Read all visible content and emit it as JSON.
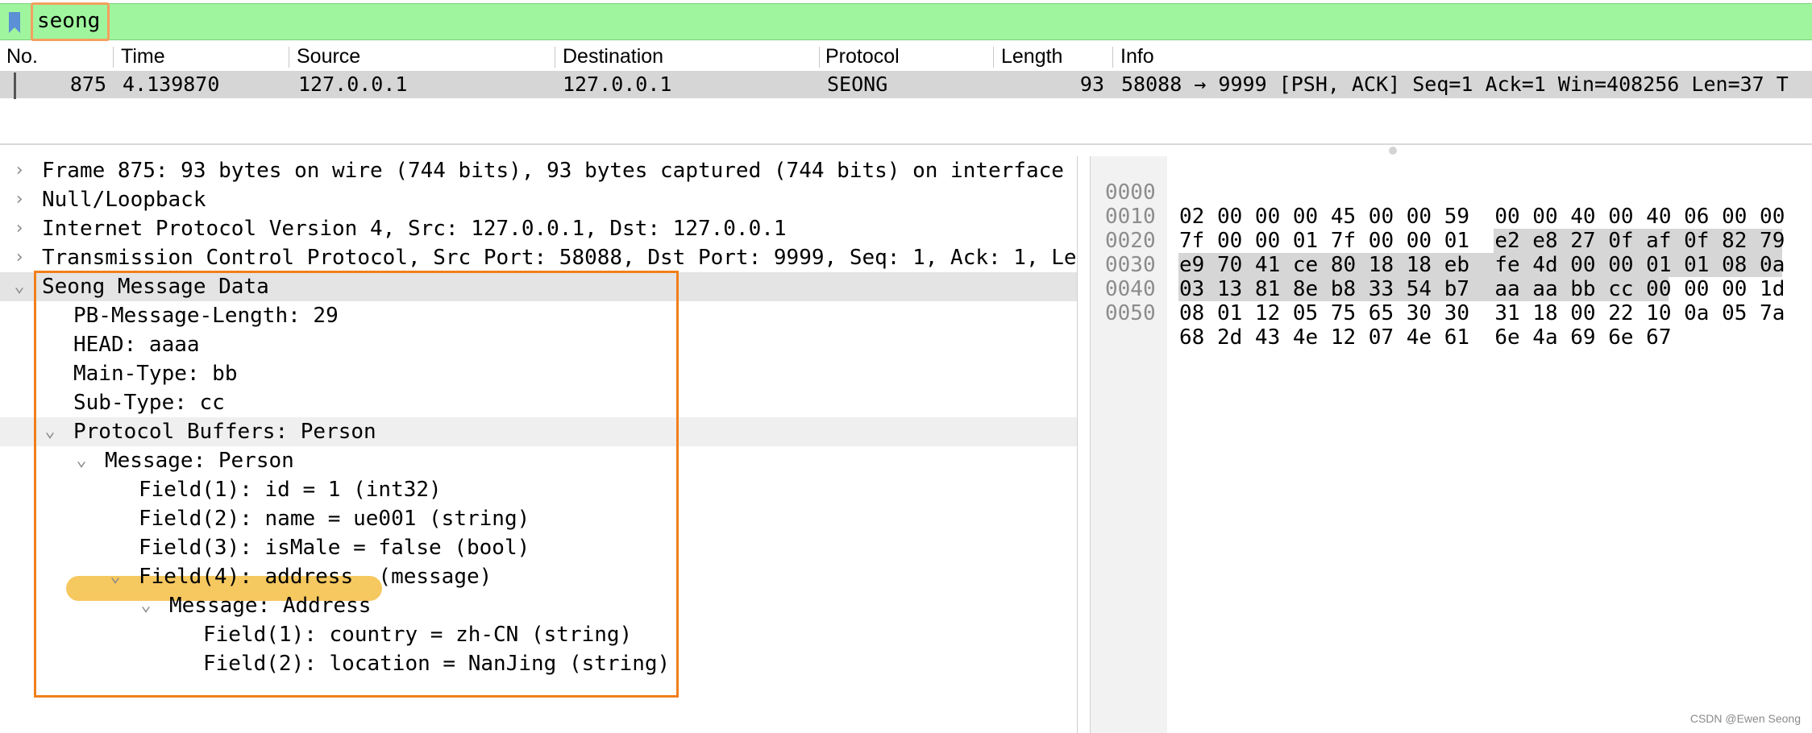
{
  "filter": {
    "text": "seong",
    "bookmark_icon": "bookmark-icon"
  },
  "packet_list": {
    "columns": [
      "No.",
      "Time",
      "Source",
      "Destination",
      "Protocol",
      "Length",
      "Info"
    ],
    "row": {
      "no": "875",
      "time": "4.139870",
      "source": "127.0.0.1",
      "destination": "127.0.0.1",
      "protocol": "SEONG",
      "length": "93",
      "info": "58088 → 9999 [PSH, ACK] Seq=1 Ack=1 Win=408256 Len=37 T"
    }
  },
  "details": [
    {
      "text": "Frame 875: 93 bytes on wire (744 bits), 93 bytes captured (744 bits) on interface",
      "expander": "›"
    },
    {
      "text": "Null/Loopback",
      "expander": "›"
    },
    {
      "text": "Internet Protocol Version 4, Src: 127.0.0.1, Dst: 127.0.0.1",
      "expander": "›"
    },
    {
      "text": "Transmission Control Protocol, Src Port: 58088, Dst Port: 9999, Seq: 1, Ack: 1, Len",
      "expander": "›"
    },
    {
      "text": "Seong Message Data",
      "expander": "⌄"
    },
    {
      "text": "PB-Message-Length: 29",
      "expander": ""
    },
    {
      "text": "HEAD: aaaa",
      "expander": ""
    },
    {
      "text": "Main-Type: bb",
      "expander": ""
    },
    {
      "text": "Sub-Type: cc",
      "expander": ""
    },
    {
      "text": "Protocol Buffers: Person",
      "expander": "⌄"
    },
    {
      "text": "Message: Person",
      "expander": "⌄"
    },
    {
      "text": "Field(1): id = 1 (int32)",
      "expander": ""
    },
    {
      "text": "Field(2): name = ue001 (string)",
      "expander": ""
    },
    {
      "text": "Field(3): isMale = false (bool)",
      "expander": ""
    },
    {
      "text": "Field(4): address  (message)",
      "expander": "⌄"
    },
    {
      "text": "Message: Address",
      "expander": "⌄"
    },
    {
      "text": "Field(1): country = zh-CN (string)",
      "expander": ""
    },
    {
      "text": "Field(2): location = NanJing (string)",
      "expander": ""
    }
  ],
  "hex": [
    {
      "offset": "0000",
      "bytes": "02 00 00 00 45 00 00 59  00 00 40 00 40 06 00 00"
    },
    {
      "offset": "0010",
      "bytes": "7f 00 00 01 7f 00 00 01  e2 e8 27 0f af 0f 82 79"
    },
    {
      "offset": "0020",
      "bytes": "e9 70 41 ce 80 18 18 eb  fe 4d 00 00 01 01 08 0a"
    },
    {
      "offset": "0030",
      "bytes": "03 13 81 8e b8 33 54 b7  aa aa bb cc 00 00 00 1d"
    },
    {
      "offset": "0040",
      "bytes": "08 01 12 05 75 65 30 30  31 18 00 22 10 0a 05 7a"
    },
    {
      "offset": "0050",
      "bytes": "68 2d 43 4e 12 07 4e 61  6e 4a 69 6e 67"
    }
  ],
  "watermark": "CSDN @Ewen Seong",
  "colors": {
    "filter_valid": "#9ff59d",
    "selection": "#d6d6d6",
    "highlight_box": "#f07f1c",
    "field_highlight": "#f5c860"
  }
}
